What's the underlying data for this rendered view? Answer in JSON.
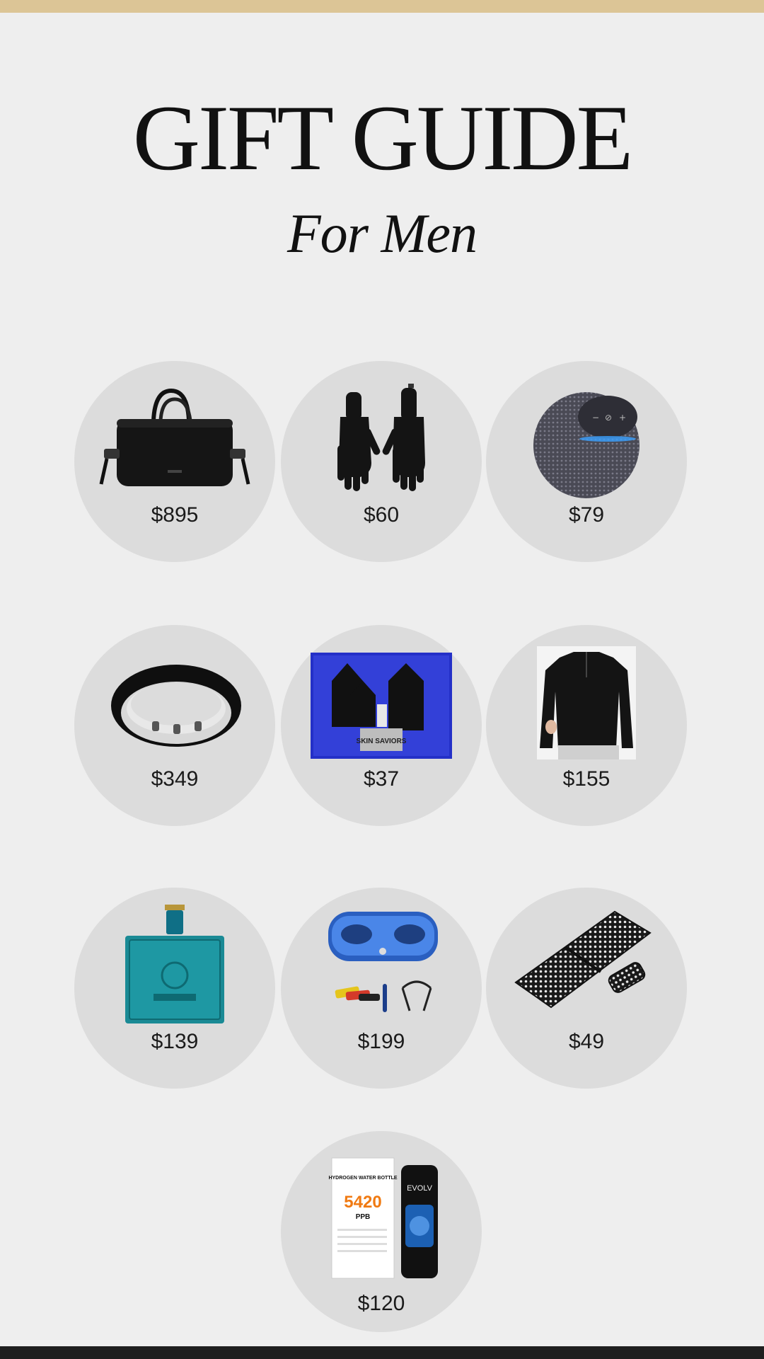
{
  "header": {
    "title": "GIFT GUIDE",
    "subtitle": "For Men"
  },
  "colors": {
    "top_bar": "#dcc596",
    "bottom_bar": "#1e1e1e",
    "background": "#eeeeee",
    "circle": "#dcdcdc"
  },
  "products": [
    {
      "icon": "duffel-bag-icon",
      "price": "$895"
    },
    {
      "icon": "gloves-icon",
      "price": "$60"
    },
    {
      "icon": "smart-speaker-icon",
      "price": "$79"
    },
    {
      "icon": "smart-ring-icon",
      "price": "$349"
    },
    {
      "icon": "skincare-set-icon",
      "price": "$37",
      "box_label": "SKIN SAVIORS"
    },
    {
      "icon": "quarter-zip-sweater-icon",
      "price": "$155"
    },
    {
      "icon": "cologne-bottle-icon",
      "price": "$139"
    },
    {
      "icon": "vibration-plate-icon",
      "price": "$199"
    },
    {
      "icon": "acupressure-mat-icon",
      "price": "$49"
    },
    {
      "icon": "hydrogen-water-bottle-icon",
      "price": "$120",
      "box_label": "HYDROGEN WATER BOTTLE",
      "box_value": "5420",
      "box_unit": "PPB",
      "brand": "EVOLV"
    }
  ]
}
